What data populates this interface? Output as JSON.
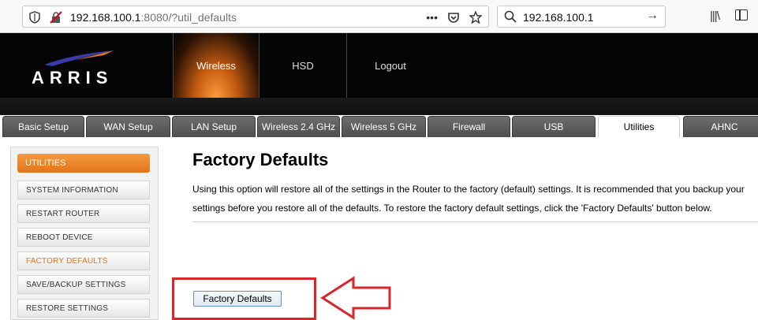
{
  "browser": {
    "url_host": "192.168.100.1",
    "url_rest": ":8080/?util_defaults",
    "search_text": "192.168.100.1",
    "menu_dots": "•••",
    "icons": [
      "shield-icon",
      "insecure-connection-icon",
      "pocket-icon",
      "bookmark-star-icon",
      "search-icon",
      "arrow-right-icon",
      "library-icon",
      "sidebar-icon"
    ]
  },
  "header": {
    "logo_text": "ARRIS",
    "top_nav": [
      {
        "label": "Wireless",
        "active": true
      },
      {
        "label": "HSD",
        "active": false
      },
      {
        "label": "Logout",
        "active": false
      }
    ],
    "accent_color": "#e2741a"
  },
  "tabs": [
    {
      "label": "Basic Setup"
    },
    {
      "label": "WAN Setup"
    },
    {
      "label": "LAN Setup"
    },
    {
      "label": "Wireless 2.4 GHz"
    },
    {
      "label": "Wireless 5 GHz"
    },
    {
      "label": "Firewall"
    },
    {
      "label": "USB"
    },
    {
      "label": "Utilities",
      "active": true
    },
    {
      "label": "AHNC"
    }
  ],
  "sidebar": {
    "header": "UTILITIES",
    "items": [
      {
        "label": "SYSTEM INFORMATION"
      },
      {
        "label": "RESTART ROUTER"
      },
      {
        "label": "REBOOT DEVICE"
      },
      {
        "label": "FACTORY DEFAULTS",
        "active": true
      },
      {
        "label": "SAVE/BACKUP SETTINGS"
      },
      {
        "label": "RESTORE SETTINGS"
      }
    ]
  },
  "main": {
    "title": "Factory Defaults",
    "description": "Using this option will restore all of the settings in the Router to the factory (default) settings. It is recommended that you backup your settings before you restore all of the defaults. To restore the factory default settings, click the 'Factory Defaults' button below.",
    "button_label": "Factory Defaults",
    "highlight_color": "#d9262b"
  }
}
